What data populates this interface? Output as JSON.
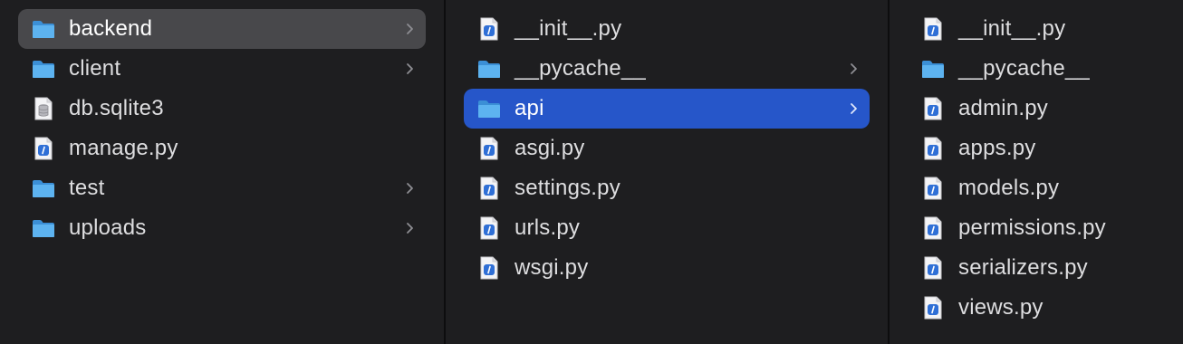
{
  "columns": [
    {
      "items": [
        {
          "label": "backend",
          "type": "folder",
          "chevron": true,
          "selected": "inactive"
        },
        {
          "label": "client",
          "type": "folder",
          "chevron": true
        },
        {
          "label": "db.sqlite3",
          "type": "database"
        },
        {
          "label": "manage.py",
          "type": "python"
        },
        {
          "label": "test",
          "type": "folder",
          "chevron": true
        },
        {
          "label": "uploads",
          "type": "folder",
          "chevron": true
        }
      ]
    },
    {
      "items": [
        {
          "label": "__init__.py",
          "type": "python"
        },
        {
          "label": "__pycache__",
          "type": "folder",
          "chevron": true
        },
        {
          "label": "api",
          "type": "folder",
          "chevron": true,
          "selected": "active"
        },
        {
          "label": "asgi.py",
          "type": "python"
        },
        {
          "label": "settings.py",
          "type": "python"
        },
        {
          "label": "urls.py",
          "type": "python"
        },
        {
          "label": "wsgi.py",
          "type": "python"
        }
      ]
    },
    {
      "items": [
        {
          "label": "__init__.py",
          "type": "python"
        },
        {
          "label": "__pycache__",
          "type": "folder"
        },
        {
          "label": "admin.py",
          "type": "python"
        },
        {
          "label": "apps.py",
          "type": "python"
        },
        {
          "label": "models.py",
          "type": "python"
        },
        {
          "label": "permissions.py",
          "type": "python"
        },
        {
          "label": "serializers.py",
          "type": "python"
        },
        {
          "label": "views.py",
          "type": "python"
        }
      ]
    }
  ],
  "colors": {
    "background": "#1e1e20",
    "selection_active": "#2656c9",
    "selection_inactive": "#48484b",
    "folder": "#4aa3e6",
    "text": "#dedee0"
  }
}
